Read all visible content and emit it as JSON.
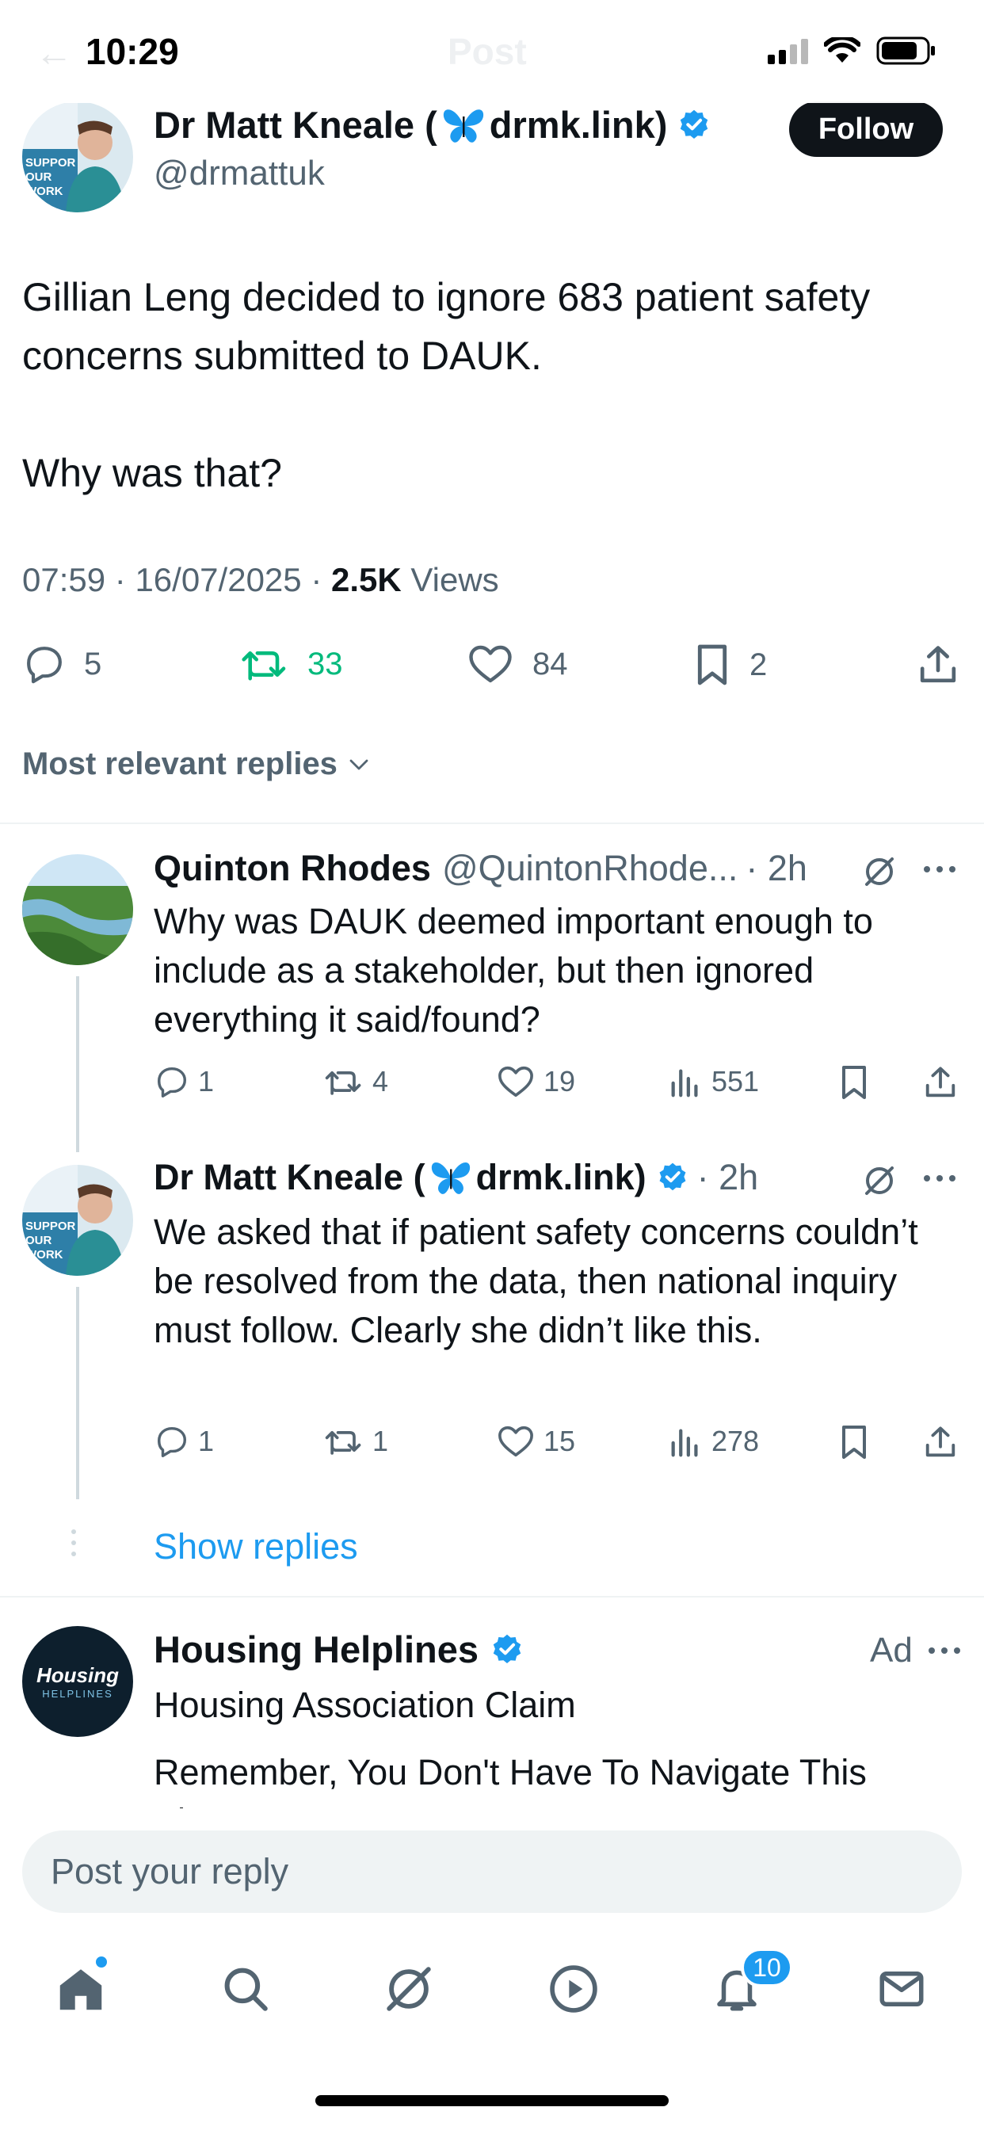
{
  "status_bar": {
    "time": "10:29",
    "ghost_title": "Post",
    "ghost_back": "←"
  },
  "post": {
    "author_name_prefix": "Dr Matt Kneale (",
    "author_name_suffix": "drmk.link)",
    "handle": "@drmattuk",
    "follow_label": "Follow",
    "text": "Gillian Leng decided to ignore 683 patient safety concerns submitted to DAUK.\n\nWhy was that?",
    "time": "07:59",
    "date": "16/07/2025",
    "views_count": "2.5K",
    "views_label": "Views",
    "replies": "5",
    "reposts": "33",
    "likes": "84",
    "bookmarks": "2",
    "avatar_badge_text": "SUPPOR\nOUR\nWORK"
  },
  "sort": {
    "label": "Most relevant replies"
  },
  "replies": [
    {
      "name": "Quinton Rhodes",
      "handle": "@QuintonRhode...",
      "time": "· 2h",
      "text": "Why was DAUK deemed important enough to include as a stakeholder, but then ignored everything it said/found?",
      "replies": "1",
      "reposts": "4",
      "likes": "19",
      "views": "551"
    },
    {
      "name_prefix": "Dr Matt Kneale (",
      "name_suffix": "drmk.link)",
      "time": "· 2h",
      "text": "We asked that if patient safety concerns couldn’t be resolved from the data, then national inquiry must follow. Clearly she didn’t like this.",
      "replies": "1",
      "reposts": "1",
      "likes": "15",
      "views": "278"
    }
  ],
  "show_replies": "Show replies",
  "ad": {
    "name": "Housing Helplines",
    "tag": "Ad",
    "headline": "Housing Association Claim",
    "body": "Remember, You Don't Have To Navigate This Alone",
    "logo_line1": "Housing",
    "logo_line2": "HELPLINES"
  },
  "compose": {
    "placeholder": "Post your reply"
  },
  "tabs": {
    "items": [
      "home-icon",
      "search-icon",
      "grok-icon",
      "video-icon",
      "notifications-icon",
      "messages-icon"
    ],
    "notifications_badge": "10"
  },
  "colors": {
    "accent": "#1d9bf0",
    "repost": "#00ba7c",
    "muted": "#536471",
    "text": "#0f1419",
    "divider": "#eff3f4"
  }
}
